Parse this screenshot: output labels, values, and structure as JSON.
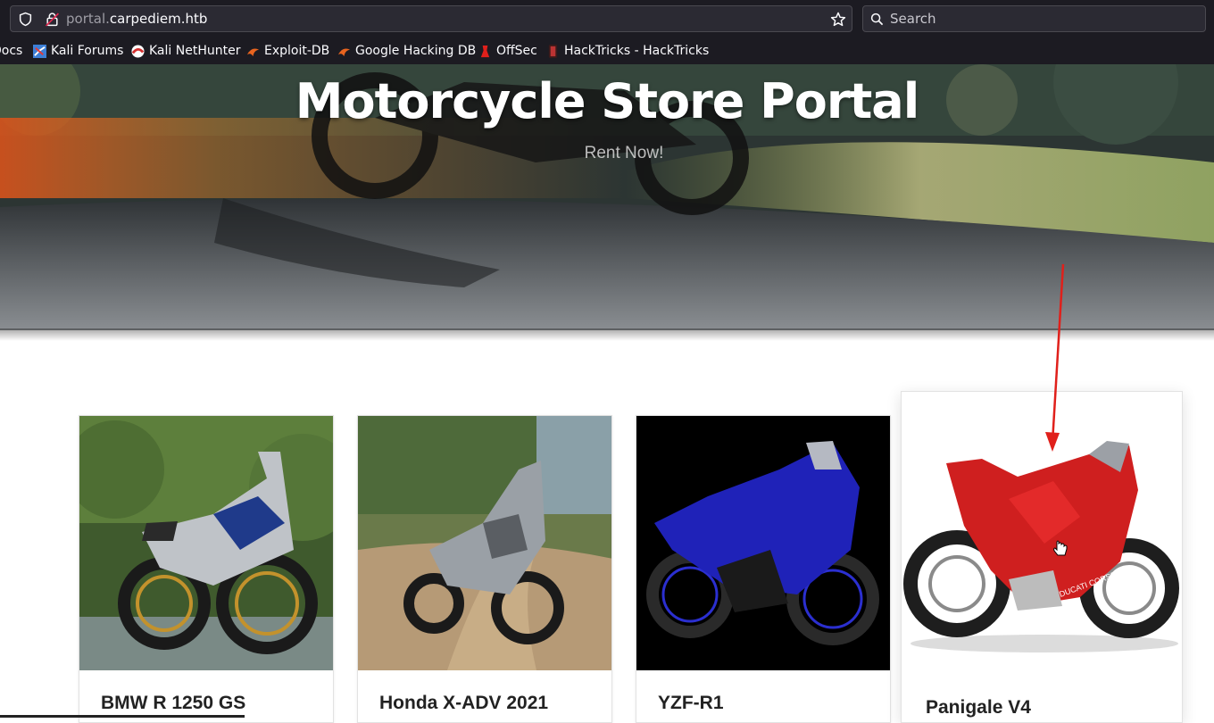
{
  "browser": {
    "url_prefix": "portal.",
    "url_host": "carpediem.htb",
    "search_placeholder": "Search",
    "bookmarks": [
      {
        "label": "Docs",
        "icon": "docs-icon"
      },
      {
        "label": "Kali Forums",
        "icon": "kali-forums-icon"
      },
      {
        "label": "Kali NetHunter",
        "icon": "kali-nethunter-icon"
      },
      {
        "label": "Exploit-DB",
        "icon": "exploit-db-icon"
      },
      {
        "label": "Google Hacking DB",
        "icon": "google-hacking-db-icon"
      },
      {
        "label": "OffSec",
        "icon": "offsec-icon"
      },
      {
        "label": "HackTricks - HackTricks",
        "icon": "hacktricks-icon"
      }
    ]
  },
  "hero": {
    "title": "Motorcycle Store Portal",
    "subtitle": "Rent Now!"
  },
  "products": [
    {
      "name": "BMW R 1250 GS",
      "image": "bmw-r1250gs-image"
    },
    {
      "name": "Honda X-ADV 2021",
      "image": "honda-xadv-image"
    },
    {
      "name": "YZF-R1",
      "image": "yamaha-yzf-r1-image"
    },
    {
      "name": "Panigale V4",
      "image": "ducati-panigale-v4-image"
    }
  ],
  "colors": {
    "annotation_arrow": "#e0201b",
    "browser_bg": "#1c1b22",
    "page_bg": "#ffffff"
  }
}
